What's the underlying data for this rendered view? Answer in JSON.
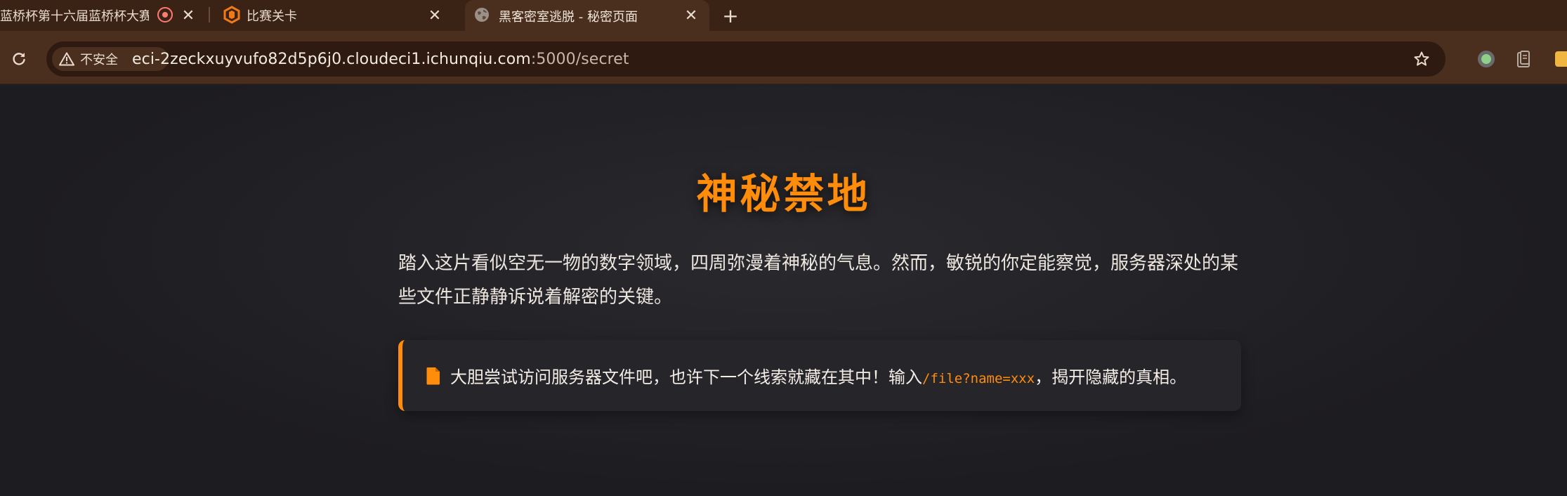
{
  "browser": {
    "tabs": [
      {
        "title": "蓝桥杯第十六届蓝桥杯大赛",
        "active": false
      },
      {
        "title": "比赛关卡",
        "active": false
      },
      {
        "title": "黑客密室逃脱 - 秘密页面",
        "active": true
      }
    ],
    "new_tab_label": "+",
    "close_glyph": "✕",
    "security_label": "不安全",
    "url_host": "eci-2zeckxuyvufo82d5p6j0.cloudeci1.ichunqiu.com",
    "url_path": ":5000/secret",
    "colors": {
      "tab_strip": "#3a2214",
      "toolbar": "#4a2e1e",
      "omnibox": "#2e1a10"
    },
    "icons": [
      "reload-icon",
      "warning-icon",
      "star-icon",
      "extension-icon",
      "globe-icon"
    ]
  },
  "page": {
    "title": "神秘禁地",
    "intro": "踏入这片看似空无一物的数字领域，四周弥漫着神秘的气息。然而，敏锐的你定能察觉，服务器深处的某些文件正静静诉说着解密的关键。",
    "hint_before": "大胆尝试访问服务器文件吧，也许下一个线索就藏在其中！输入",
    "hint_code": "/file?name=xxx",
    "hint_after": "，揭开隐藏的真相。",
    "accent_color": "#ff8c0b",
    "background_color": "#1f1e22"
  }
}
